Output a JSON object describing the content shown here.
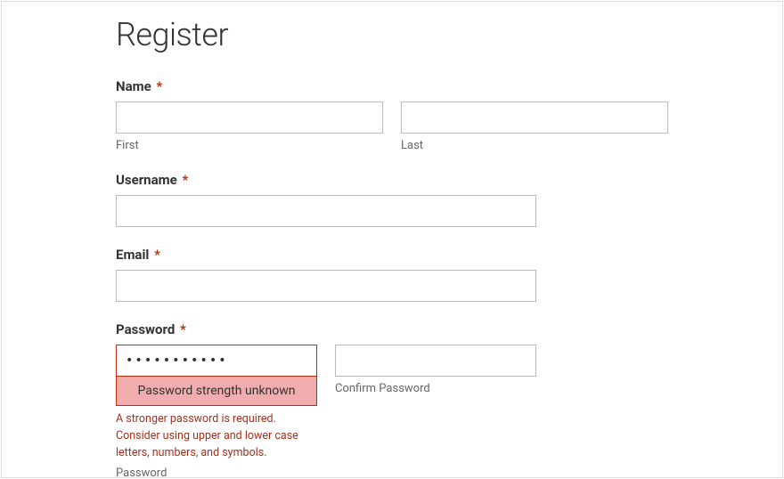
{
  "title": "Register",
  "fields": {
    "name": {
      "label": "Name",
      "required": "*",
      "first_sublabel": "First",
      "last_sublabel": "Last",
      "first_value": "",
      "last_value": ""
    },
    "username": {
      "label": "Username",
      "required": "*",
      "value": ""
    },
    "email": {
      "label": "Email",
      "required": "*",
      "value": ""
    },
    "password": {
      "label": "Password",
      "required": "*",
      "value": "•••••••••••",
      "confirm_value": "",
      "confirm_sublabel": "Confirm Password",
      "password_sublabel": "Password",
      "strength_text": "Password strength unknown",
      "error_message": "A stronger password is required. Consider using upper and lower case letters, numbers, and symbols."
    }
  }
}
